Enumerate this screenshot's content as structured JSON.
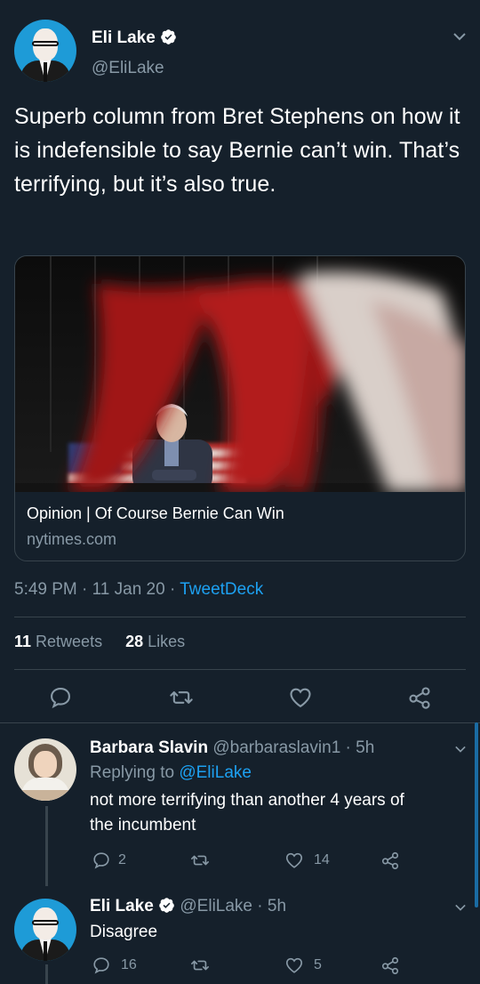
{
  "tweet": {
    "author_name": "Eli Lake",
    "author_handle": "@EliLake",
    "text": "Superb column from Bret Stephens on how it is indefensible to say Bernie can’t win. That’s terrifying, but it’s also true.",
    "card": {
      "title": "Opinion | Of Course Bernie Can Win",
      "domain": "nytimes.com"
    },
    "time": "5:49 PM · 11 Jan 20 · ",
    "source": "TweetDeck",
    "retweets_count": "11",
    "retweets_label": " Retweets",
    "likes_count": "28",
    "likes_label": " Likes"
  },
  "icons": {
    "reply": "reply-icon",
    "retweet": "retweet-icon",
    "like": "heart-icon",
    "share": "share-icon",
    "caret": "chevron-down-icon",
    "verified": "verified-badge-icon"
  },
  "replies": [
    {
      "author_name": "Barbara Slavin",
      "meta": " @barbaraslavin1 · 5h",
      "replying_prefix": "Replying to ",
      "replying_to": "@EliLake",
      "text_line1": "not more terrifying than another 4 years of",
      "text_line2": "the incumbent",
      "reply_count": "2",
      "retweet_count": "",
      "like_count": "14"
    },
    {
      "author_name": "Eli Lake",
      "meta": " @EliLake · 5h",
      "text": "Disagree",
      "reply_count": "16",
      "retweet_count": "",
      "like_count": "5"
    }
  ],
  "colors": {
    "background": "#15202b",
    "border": "#38444d",
    "muted": "#8899a6",
    "accent": "#1da1f2"
  }
}
